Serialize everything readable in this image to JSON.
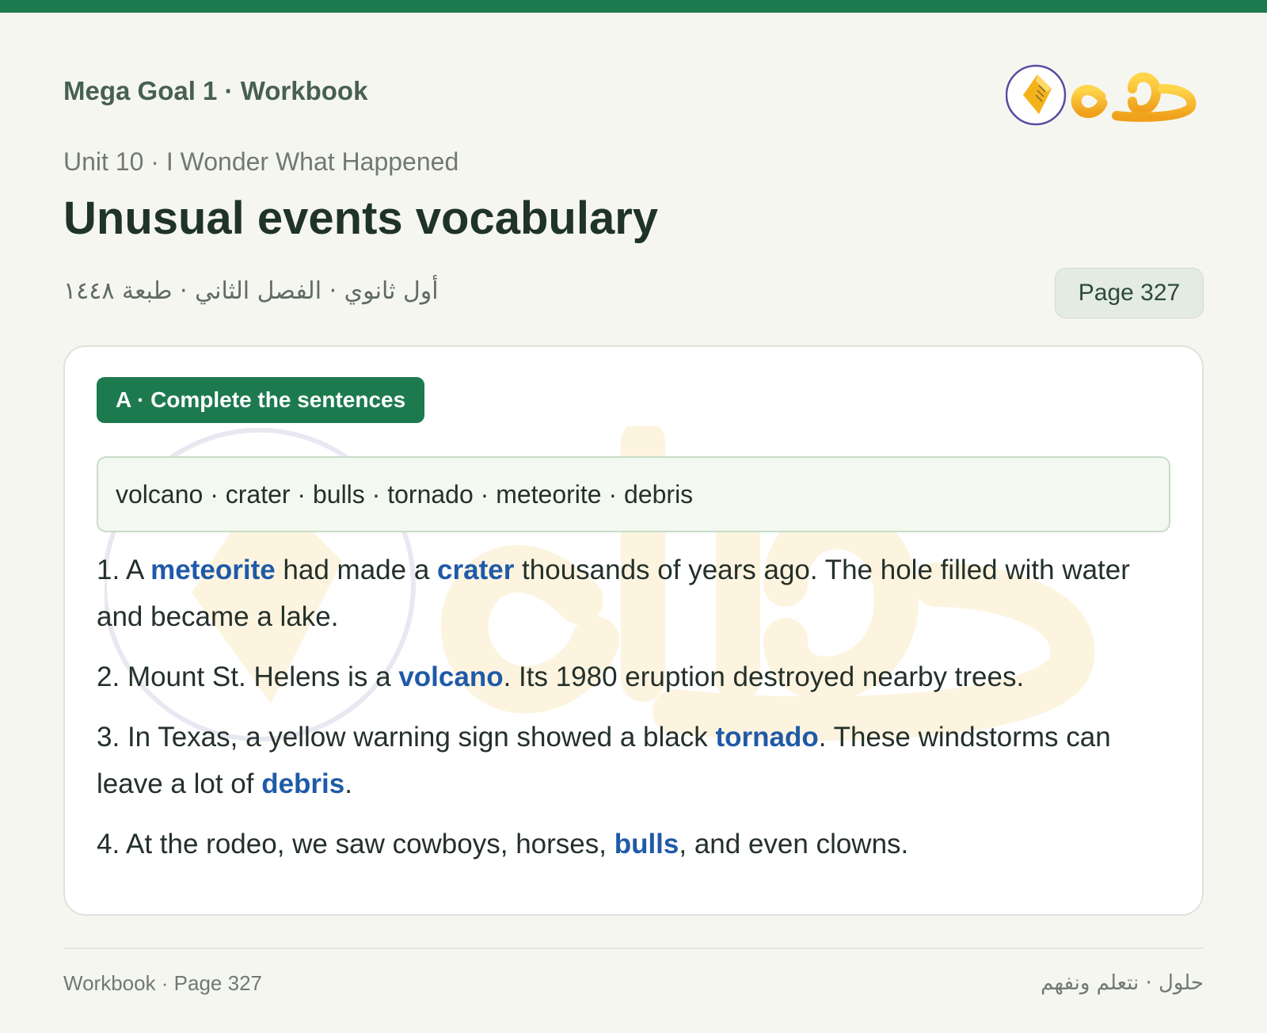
{
  "header": {
    "book_title": "Mega Goal 1 · Workbook",
    "logo_text": "حلول",
    "unit_line": "Unit 10 · I Wonder What Happened",
    "page_title": "Unusual events vocabulary",
    "arabic_meta": "أول ثانوي · الفصل الثاني · طبعة ١٤٤٨",
    "page_badge": "Page 327"
  },
  "exercise": {
    "section_label": "A · Complete the sentences",
    "word_bank": "volcano · crater · bulls · tornado · meteorite · debris",
    "items": [
      {
        "number": "1.",
        "parts": [
          "A ",
          "meteorite",
          " had made a ",
          "crater",
          " thousands of years ago. The hole filled with water and became a lake."
        ]
      },
      {
        "number": "2.",
        "parts": [
          "Mount St. Helens is a ",
          "volcano",
          ". Its 1980 eruption destroyed nearby trees."
        ]
      },
      {
        "number": "3.",
        "parts": [
          "In Texas, a yellow warning sign showed a black ",
          "tornado",
          ". These windstorms can leave a lot of ",
          "debris",
          "."
        ]
      },
      {
        "number": "4.",
        "parts": [
          "At the rodeo, we saw cowboys, horses, ",
          "bulls",
          ", and even clowns."
        ]
      }
    ]
  },
  "footer": {
    "left": "Workbook · Page 327",
    "right": "حلول · نتعلم ونفهم"
  },
  "colors": {
    "accent_green": "#1d7a4e",
    "answer_blue": "#1f5aa8",
    "logo_gold": "#f4b21a",
    "logo_ring": "#5b4ba0"
  }
}
